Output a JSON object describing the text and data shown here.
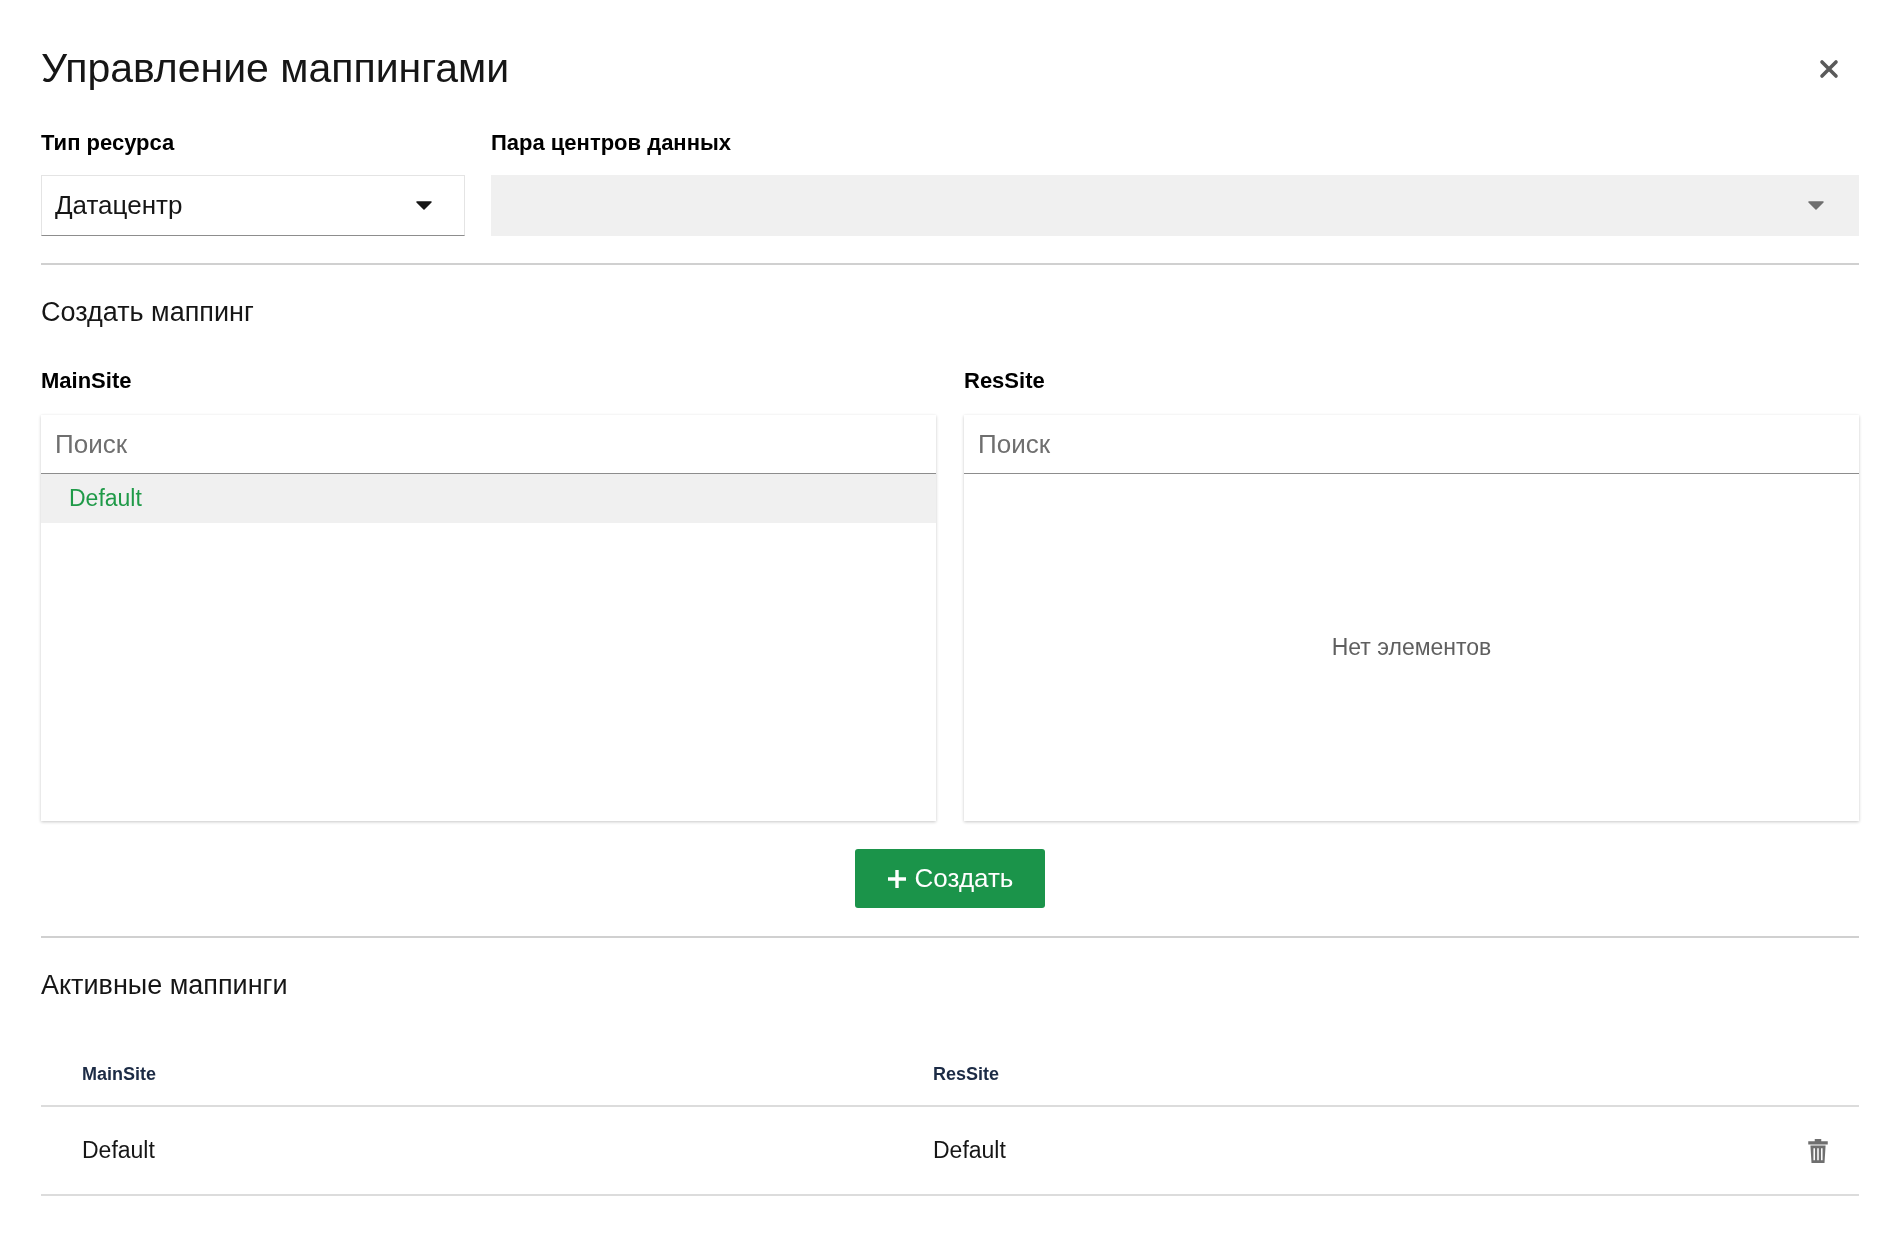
{
  "dialog": {
    "title": "Управление маппингами"
  },
  "filters": [
    {
      "label": "Тип ресурса",
      "value": "Датацентр",
      "disabled": false
    },
    {
      "label": "Пара центров данных",
      "disabled": true
    }
  ],
  "create_section": {
    "heading": "Создать маппинг",
    "lists": [
      {
        "label": "MainSite",
        "search": {
          "placeholder": "Поиск"
        },
        "items": [
          {
            "label": "Default",
            "selected": true
          }
        ]
      },
      {
        "label": "ResSite",
        "search": {
          "placeholder": "Поиск"
        },
        "empty_text": "Нет элементов"
      }
    ],
    "button": "Создать"
  },
  "active_section": {
    "heading": "Активные маппинги",
    "table": {
      "columns": [
        "MainSite",
        "ResSite"
      ],
      "rows": [
        {
          "cells": [
            "Default",
            "Default"
          ]
        }
      ]
    }
  }
}
